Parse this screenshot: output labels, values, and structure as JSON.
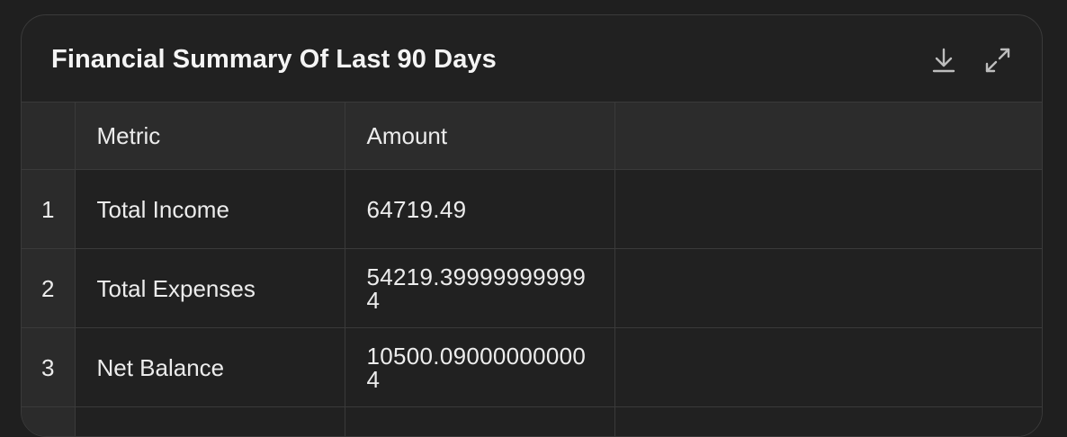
{
  "card": {
    "title": "Financial Summary Of Last 90 Days",
    "icons": {
      "download": "download-icon",
      "expand": "expand-icon"
    }
  },
  "table": {
    "columns": [
      "",
      "Metric",
      "Amount",
      ""
    ],
    "rows": [
      {
        "index": "1",
        "metric": "Total Income",
        "amount": "64719.49"
      },
      {
        "index": "2",
        "metric": "Total Expenses",
        "amount": "54219.399999999994"
      },
      {
        "index": "3",
        "metric": "Net Balance",
        "amount": "10500.090000000004"
      }
    ]
  },
  "colors": {
    "background": "#1f1f1f",
    "card": "#212121",
    "header_row": "#2c2c2c",
    "border": "#3a3a3a",
    "text": "#ececec"
  }
}
